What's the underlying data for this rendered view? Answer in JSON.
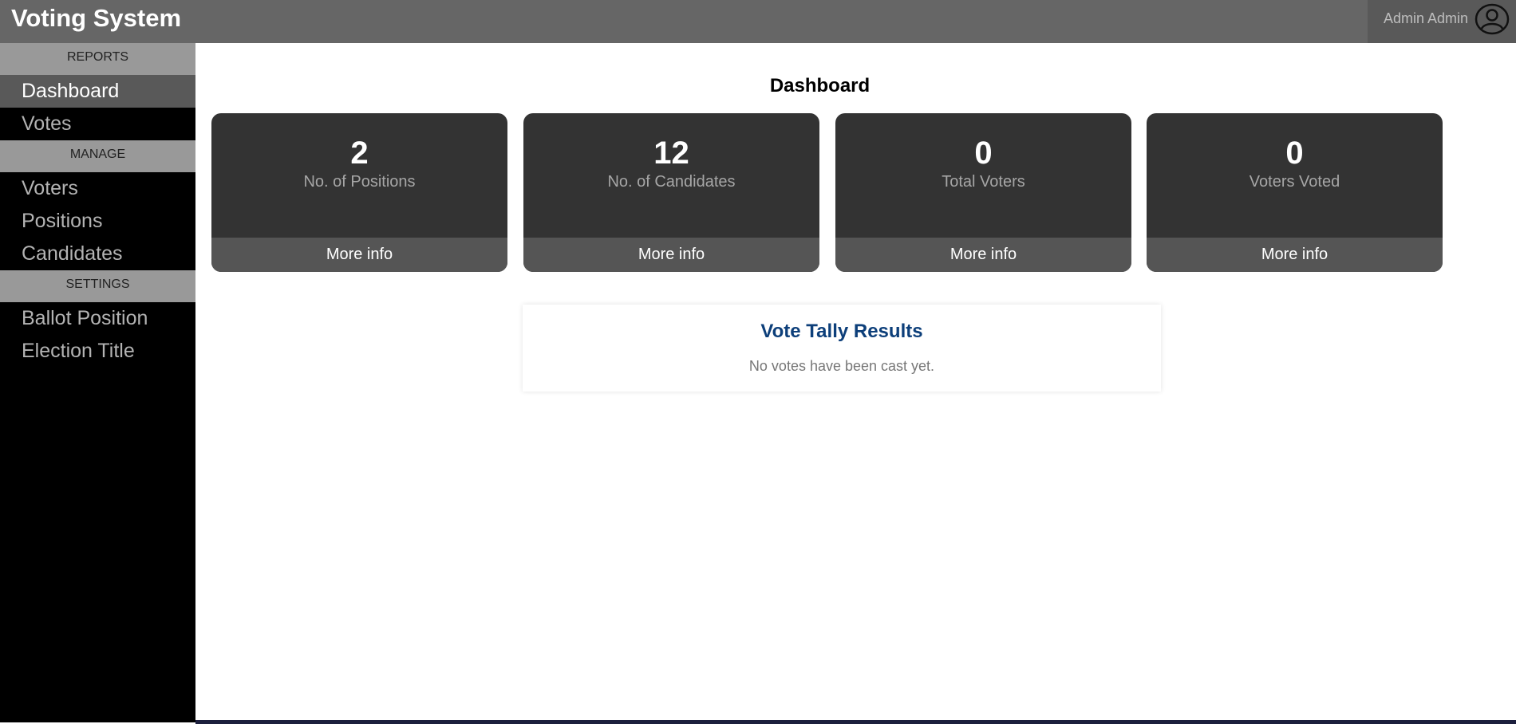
{
  "header": {
    "app_title": "Voting System",
    "user_name": "Admin Admin",
    "user_icon": "user-circle-icon"
  },
  "sidebar": {
    "sections": [
      {
        "title": "REPORTS",
        "items": [
          {
            "label": "Dashboard",
            "active": true
          },
          {
            "label": "Votes",
            "active": false
          }
        ]
      },
      {
        "title": "MANAGE",
        "items": [
          {
            "label": "Voters",
            "active": false
          },
          {
            "label": "Positions",
            "active": false
          },
          {
            "label": "Candidates",
            "active": false
          }
        ]
      },
      {
        "title": "SETTINGS",
        "items": [
          {
            "label": "Ballot Position",
            "active": false
          },
          {
            "label": "Election Title",
            "active": false
          }
        ]
      }
    ]
  },
  "main": {
    "title": "Dashboard",
    "cards": [
      {
        "value": "2",
        "label": "No. of Positions",
        "more": "More info"
      },
      {
        "value": "12",
        "label": "No. of Candidates",
        "more": "More info"
      },
      {
        "value": "0",
        "label": "Total Voters",
        "more": "More info"
      },
      {
        "value": "0",
        "label": "Voters Voted",
        "more": "More info"
      }
    ],
    "tally": {
      "title": "Vote Tally Results",
      "message": "No votes have been cast yet."
    }
  },
  "colors": {
    "topbar": "#666666",
    "sidebar": "#000000",
    "card": "#333333",
    "card_footer": "#555555",
    "tally_title": "#0d3f7a"
  }
}
